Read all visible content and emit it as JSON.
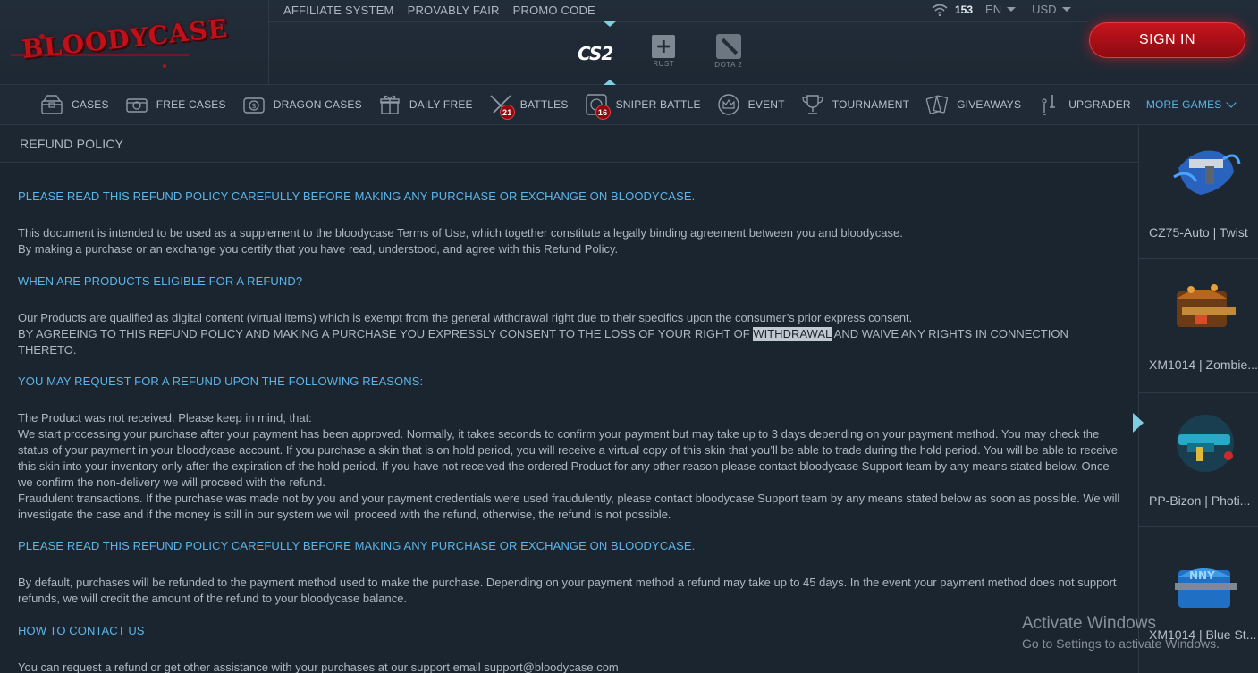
{
  "brand": {
    "logo_text": "BLOODYCASE"
  },
  "header": {
    "top_links": [
      "AFFILIATE SYSTEM",
      "PROVABLY FAIR",
      "PROMO CODE"
    ],
    "online_count": "153",
    "language": "EN",
    "currency": "USD",
    "games": [
      {
        "label": "CS2",
        "icon": "cs2-logo"
      },
      {
        "label": "RUST",
        "icon": "rust-icon"
      },
      {
        "label": "DOTA 2",
        "icon": "dota2-icon"
      }
    ],
    "sign_in": "SIGN IN"
  },
  "nav": {
    "items": [
      {
        "label": "CASES",
        "icon": "cases-icon"
      },
      {
        "label": "FREE CASES",
        "icon": "free-cases-icon"
      },
      {
        "label": "DRAGON CASES",
        "icon": "dragon-cases-icon"
      },
      {
        "label": "DAILY FREE",
        "icon": "gift-icon"
      },
      {
        "label": "BATTLES",
        "icon": "crossed-swords-icon",
        "badge": "21"
      },
      {
        "label": "SNIPER BATTLE",
        "icon": "crosshair-icon",
        "badge": "16"
      },
      {
        "label": "EVENT",
        "icon": "crown-icon"
      },
      {
        "label": "TOURNAMENT",
        "icon": "trophy-icon"
      },
      {
        "label": "GIVEAWAYS",
        "icon": "cards-icon"
      },
      {
        "label": "UPGRADER",
        "icon": "upgrader-icon"
      }
    ],
    "more": "MORE GAMES"
  },
  "page": {
    "title": "REFUND POLICY",
    "h1": "PLEASE READ THIS REFUND POLICY CAREFULLY BEFORE MAKING ANY PURCHASE OR EXCHANGE ON BLOODYCASE.",
    "p1a": "This document is intended to be used as a supplement to the bloodycase Terms of Use, which together constitute a legally binding agreement between you and bloodycase.",
    "p1b": "By making a purchase or an exchange you certify that you have read, understood, and agree with this Refund Policy.",
    "h2": "WHEN ARE PRODUCTS ELIGIBLE FOR A REFUND?",
    "p2a": "Our Products are qualified as digital content (virtual items) which is exempt from the general withdrawal right due to their specifics upon the consumer’s prior express consent.",
    "p2b_pre": "BY AGREEING TO THIS REFUND POLICY AND MAKING A PURCHASE YOU EXPRESSLY CONSENT TO THE LOSS OF YOUR RIGHT OF ",
    "p2b_hl": "WITHDRAWAL",
    "p2b_post": " AND WAIVE ANY RIGHTS IN CONNECTION THERETO.",
    "h3": "YOU MAY REQUEST FOR A REFUND UPON THE FOLLOWING REASONS:",
    "p3a": "The Product was not received. Please keep in mind, that:",
    "p3b": "We start processing your purchase after your payment has been approved. Normally, it takes seconds to confirm your payment but may take up to 3 days depending on your payment method. You may check the status of your payment in your bloodycase account. If you purchase a skin that is on hold period, you will receive a virtual copy of this skin that you’ll be able to trade during the hold period. You will be able to receive this skin into your inventory only after the expiration of the hold period. If you have not received the ordered Product for any other reason please contact bloodycase Support team by any means stated below. Once we confirm the non-delivery we will proceed with the refund.",
    "p3c": "Fraudulent transactions. If the purchase was made not by you and your payment credentials were used fraudulently, please contact bloodycase Support team by any means stated below as soon as possible. We will investigate the case and if the money is still in our system we will proceed with the refund, otherwise, the refund is not possible.",
    "h4": "PLEASE READ THIS REFUND POLICY CAREFULLY BEFORE MAKING ANY PURCHASE OR EXCHANGE ON BLOODYCASE.",
    "p4": "By default, purchases will be refunded to the payment method used to make the purchase. Depending on your payment method a refund may take up to 45 days. In the event your payment method does not support refunds, we will credit the amount of the refund to your bloodycase balance.",
    "h5": "HOW TO CONTACT US",
    "p5": "You can request a refund or get other assistance with your purchases at our support email support@bloodycase.com"
  },
  "live_drops": [
    {
      "name": "CZ75-Auto | Twist",
      "color": "#3a8fe0"
    },
    {
      "name": "XM1014 | Zombie...",
      "color": "#d98a2a"
    },
    {
      "name": "PP-Bizon | Photi...",
      "color": "#3ab0d8"
    },
    {
      "name": "XM1014 | Blue St...",
      "color": "#4a9fe8"
    }
  ],
  "watermark": {
    "line1": "Activate Windows",
    "line2": "Go to Settings to activate Windows."
  }
}
